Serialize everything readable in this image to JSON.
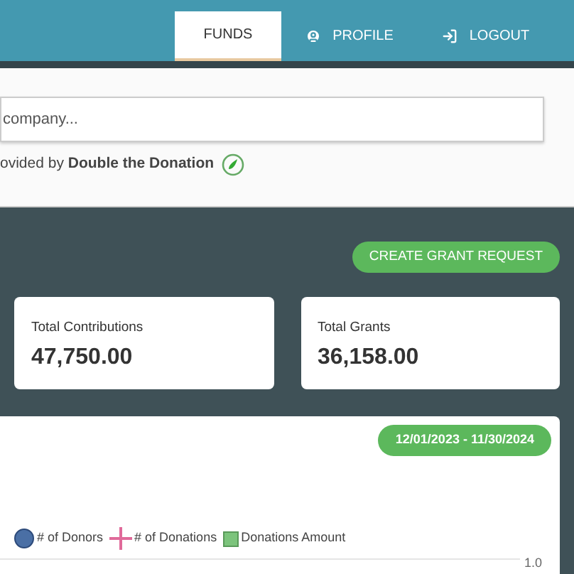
{
  "nav": [
    {
      "label": "FUNDS",
      "kind": "plain",
      "selected": true
    },
    {
      "label": "PROFILE",
      "kind": "profile",
      "selected": false
    },
    {
      "label": "LOGOUT",
      "kind": "logout",
      "selected": false
    }
  ],
  "search": {
    "placeholder": "company..."
  },
  "provider": {
    "prefix": "ovided by",
    "name": "Double the Donation"
  },
  "create_button": "CREATE GRANT REQUEST",
  "stats": [
    {
      "label": "Total Contributions",
      "value": "47,750.00"
    },
    {
      "label": "Total Grants",
      "value": "36,158.00"
    }
  ],
  "date_range": "12/01/2023 - 11/30/2024",
  "legend": [
    {
      "kind": "circle",
      "label": "# of Donors",
      "color": "#4a6fa5"
    },
    {
      "kind": "cross",
      "label": "# of Donations",
      "color": "#e06a9a"
    },
    {
      "kind": "square",
      "label": "Donations Amount",
      "color": "#7cc47c"
    }
  ],
  "axis_tick": "1.0"
}
